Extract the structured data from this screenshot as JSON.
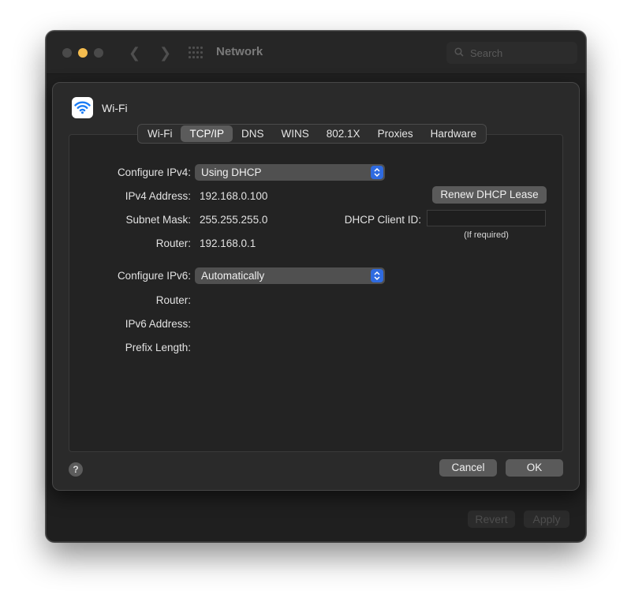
{
  "window": {
    "title": "Network",
    "search_placeholder": "Search",
    "revert_label": "Revert",
    "apply_label": "Apply"
  },
  "sheet": {
    "title": "Wi-Fi",
    "icon": "wifi-icon",
    "tabs": [
      {
        "label": "Wi-Fi",
        "active": false
      },
      {
        "label": "TCP/IP",
        "active": true
      },
      {
        "label": "DNS",
        "active": false
      },
      {
        "label": "WINS",
        "active": false
      },
      {
        "label": "802.1X",
        "active": false
      },
      {
        "label": "Proxies",
        "active": false
      },
      {
        "label": "Hardware",
        "active": false
      }
    ],
    "ipv4": {
      "configure_label": "Configure IPv4:",
      "configure_value": "Using DHCP",
      "address_label": "IPv4 Address:",
      "address_value": "192.168.0.100",
      "subnet_label": "Subnet Mask:",
      "subnet_value": "255.255.255.0",
      "router_label": "Router:",
      "router_value": "192.168.0.1",
      "renew_label": "Renew DHCP Lease",
      "client_id_label": "DHCP Client ID:",
      "client_id_value": "",
      "client_id_hint": "(If required)"
    },
    "ipv6": {
      "configure_label": "Configure IPv6:",
      "configure_value": "Automatically",
      "router_label": "Router:",
      "address_label": "IPv6 Address:",
      "prefix_label": "Prefix Length:"
    },
    "help_label": "?",
    "cancel_label": "Cancel",
    "ok_label": "OK"
  },
  "colors": {
    "window_bg": "#1f1f1f",
    "sheet_bg": "#2a2a2a",
    "accent": "#2f6be0",
    "wifi_blue": "#1a7cf5",
    "minimize_yellow": "#f5bd4f"
  }
}
